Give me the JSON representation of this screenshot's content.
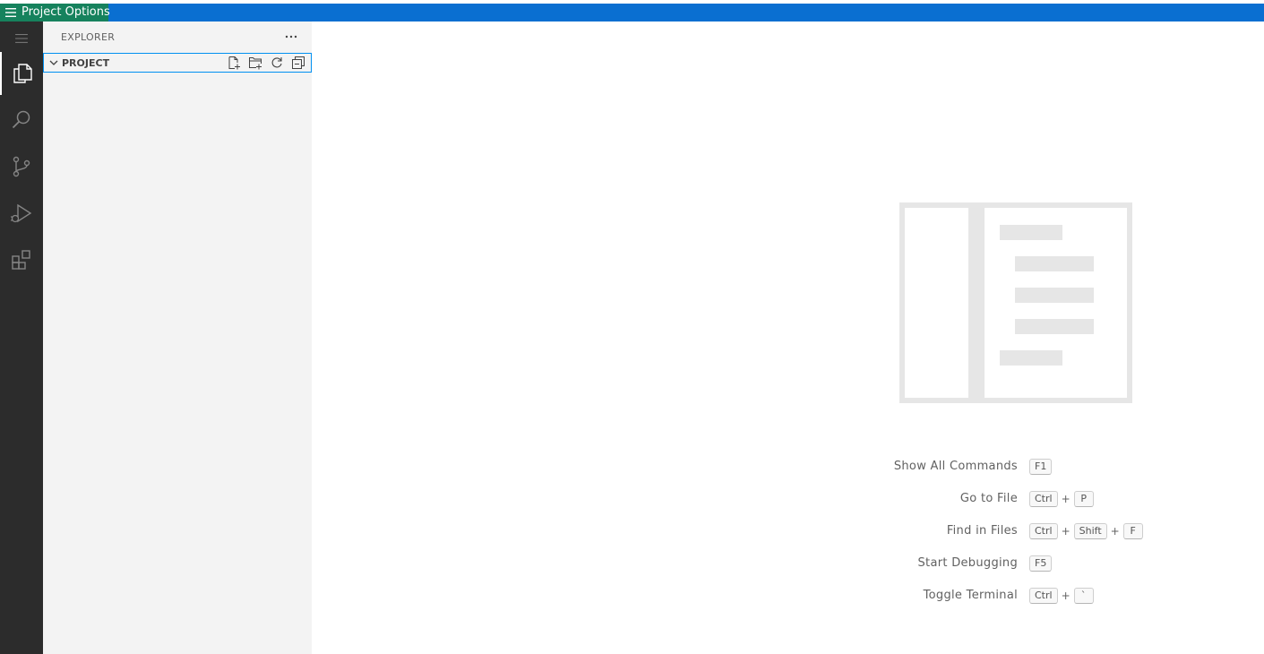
{
  "titlebar": {
    "project_options_label": "Project Options"
  },
  "activity_bar": {
    "items": [
      {
        "name": "explorer",
        "active": true
      },
      {
        "name": "search"
      },
      {
        "name": "source-control"
      },
      {
        "name": "run-debug"
      },
      {
        "name": "extensions"
      }
    ]
  },
  "sidebar": {
    "title": "EXPLORER",
    "section": {
      "label": "PROJECT"
    }
  },
  "shortcuts": [
    {
      "label": "Show All Commands",
      "keys": [
        "F1"
      ]
    },
    {
      "label": "Go to File",
      "keys": [
        "Ctrl",
        "P"
      ]
    },
    {
      "label": "Find in Files",
      "keys": [
        "Ctrl",
        "Shift",
        "F"
      ]
    },
    {
      "label": "Start Debugging",
      "keys": [
        "F5"
      ]
    },
    {
      "label": "Toggle Terminal",
      "keys": [
        "Ctrl",
        "`"
      ]
    }
  ],
  "colors": {
    "titlebar_blue": "#0a6fd1",
    "project_options_green": "#16825d",
    "activity_bar": "#2c2c2c",
    "sidebar": "#f3f3f3",
    "focus_border": "#0090f1"
  }
}
